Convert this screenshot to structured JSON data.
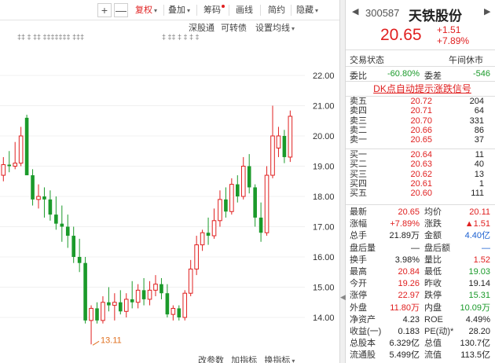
{
  "toolbar": {
    "plus": "+",
    "minus": "—",
    "items": [
      {
        "label": "复权",
        "caret": "▾",
        "active": true
      },
      {
        "label": "叠加",
        "caret": "▾",
        "active": false
      },
      {
        "label": "筹码",
        "caret": "",
        "active": false,
        "dot": true
      },
      {
        "label": "画线",
        "caret": "",
        "active": false
      },
      {
        "label": "简约",
        "caret": "",
        "active": false
      },
      {
        "label": "隐藏",
        "caret": "▾",
        "active": false
      }
    ]
  },
  "chart_options": {
    "shenguton": "深股通",
    "kezhuanzhai": "可转债",
    "setma": "设置均线",
    "setma_caret": "▾",
    "markers_left": "‡‡   ‡   ‡‡   ‡‡‡‡‡‡‡   ‡‡‡",
    "markers_right": "‡   ‡‡   ‡   ‡   ‡   ‡"
  },
  "bottom_links": {
    "item1": "改参数",
    "item2": "加指标",
    "item3": "换指标",
    "caret": "▾"
  },
  "chart_data": {
    "type": "candlestick",
    "ylim": [
      13.0,
      22.9
    ],
    "y_ticks": [
      "22.00",
      "21.00",
      "20.00",
      "19.00",
      "18.00",
      "17.00",
      "16.00",
      "15.00",
      "14.00"
    ],
    "min_annotation": "13.11",
    "up_color": "#e02020",
    "down_color": "#1a9a2a",
    "candles": [
      {
        "o": 18.7,
        "h": 19.3,
        "l": 18.5,
        "c": 19.05
      },
      {
        "o": 19.05,
        "h": 19.5,
        "l": 18.8,
        "c": 19.0
      },
      {
        "o": 19.0,
        "h": 19.8,
        "l": 18.9,
        "c": 19.1
      },
      {
        "o": 19.1,
        "h": 20.3,
        "l": 19.0,
        "c": 20.0
      },
      {
        "o": 20.6,
        "h": 20.7,
        "l": 18.7,
        "c": 18.7
      },
      {
        "o": 18.7,
        "h": 18.9,
        "l": 17.7,
        "c": 17.9
      },
      {
        "o": 17.9,
        "h": 18.4,
        "l": 17.6,
        "c": 18.0
      },
      {
        "o": 18.0,
        "h": 18.3,
        "l": 17.3,
        "c": 17.9
      },
      {
        "o": 17.9,
        "h": 18.2,
        "l": 17.2,
        "c": 17.4
      },
      {
        "o": 17.4,
        "h": 18.0,
        "l": 16.9,
        "c": 17.1
      },
      {
        "o": 17.1,
        "h": 17.7,
        "l": 16.5,
        "c": 17.0
      },
      {
        "o": 17.0,
        "h": 17.4,
        "l": 16.3,
        "c": 16.7
      },
      {
        "o": 16.7,
        "h": 17.0,
        "l": 15.8,
        "c": 16.0
      },
      {
        "o": 16.0,
        "h": 16.6,
        "l": 15.5,
        "c": 15.8
      },
      {
        "o": 15.8,
        "h": 16.0,
        "l": 13.8,
        "c": 13.9
      },
      {
        "o": 13.9,
        "h": 14.4,
        "l": 13.11,
        "c": 14.3
      },
      {
        "o": 14.3,
        "h": 14.5,
        "l": 13.8,
        "c": 13.9
      },
      {
        "o": 13.9,
        "h": 14.7,
        "l": 13.8,
        "c": 14.5
      },
      {
        "o": 14.5,
        "h": 15.0,
        "l": 14.2,
        "c": 14.4
      },
      {
        "o": 14.4,
        "h": 14.8,
        "l": 13.9,
        "c": 14.5
      },
      {
        "o": 14.5,
        "h": 14.9,
        "l": 14.1,
        "c": 14.2
      },
      {
        "o": 14.2,
        "h": 14.8,
        "l": 14.0,
        "c": 14.6
      },
      {
        "o": 14.6,
        "h": 15.2,
        "l": 14.3,
        "c": 14.5
      },
      {
        "o": 14.5,
        "h": 15.1,
        "l": 14.3,
        "c": 14.9
      },
      {
        "o": 14.9,
        "h": 15.3,
        "l": 14.4,
        "c": 14.6
      },
      {
        "o": 14.6,
        "h": 15.2,
        "l": 14.4,
        "c": 14.9
      },
      {
        "o": 14.9,
        "h": 15.4,
        "l": 14.7,
        "c": 15.1
      },
      {
        "o": 15.1,
        "h": 15.3,
        "l": 14.6,
        "c": 14.8
      },
      {
        "o": 14.8,
        "h": 15.1,
        "l": 14.0,
        "c": 14.1
      },
      {
        "o": 14.1,
        "h": 14.4,
        "l": 13.9,
        "c": 14.3
      },
      {
        "o": 14.3,
        "h": 14.4,
        "l": 13.9,
        "c": 14.0
      },
      {
        "o": 14.0,
        "h": 14.9,
        "l": 13.9,
        "c": 14.8
      },
      {
        "o": 14.8,
        "h": 15.9,
        "l": 14.7,
        "c": 15.6
      },
      {
        "o": 15.6,
        "h": 16.7,
        "l": 15.4,
        "c": 16.4
      },
      {
        "o": 16.4,
        "h": 16.9,
        "l": 16.2,
        "c": 16.8
      },
      {
        "o": 16.8,
        "h": 17.3,
        "l": 16.4,
        "c": 16.7
      },
      {
        "o": 16.7,
        "h": 17.6,
        "l": 16.6,
        "c": 17.2
      },
      {
        "o": 17.2,
        "h": 18.2,
        "l": 17.0,
        "c": 17.9
      },
      {
        "o": 17.9,
        "h": 18.3,
        "l": 17.3,
        "c": 17.5
      },
      {
        "o": 17.5,
        "h": 18.6,
        "l": 17.4,
        "c": 18.4
      },
      {
        "o": 18.4,
        "h": 18.7,
        "l": 17.8,
        "c": 18.0
      },
      {
        "o": 18.0,
        "h": 19.3,
        "l": 17.9,
        "c": 19.0
      },
      {
        "o": 19.0,
        "h": 19.4,
        "l": 18.1,
        "c": 18.3
      },
      {
        "o": 18.3,
        "h": 18.4,
        "l": 17.0,
        "c": 17.3
      },
      {
        "o": 17.3,
        "h": 17.8,
        "l": 16.5,
        "c": 16.8
      },
      {
        "o": 16.8,
        "h": 19.0,
        "l": 16.7,
        "c": 18.7
      },
      {
        "o": 18.7,
        "h": 21.0,
        "l": 18.6,
        "c": 20.0
      },
      {
        "o": 19.6,
        "h": 20.3,
        "l": 19.3,
        "c": 20.0
      },
      {
        "o": 20.0,
        "h": 20.2,
        "l": 19.1,
        "c": 19.3
      },
      {
        "o": 19.3,
        "h": 20.84,
        "l": 19.14,
        "c": 20.65
      }
    ]
  },
  "quote": {
    "nav_prev": "◀",
    "nav_next": "▶",
    "code": "300587",
    "name": "天铁股份",
    "price": "20.65",
    "change": "+1.51",
    "change_pct": "+7.89%",
    "trade_status_label": "交易状态",
    "trade_status_value": "午间休市",
    "weibi_label": "委比",
    "weibi_value": "-60.80%",
    "weicha_label": "委差",
    "weicha_value": "-546",
    "dk_link": "DK点自动提示涨跌信号",
    "sells": [
      {
        "label": "卖五",
        "price": "20.72",
        "vol": "204"
      },
      {
        "label": "卖四",
        "price": "20.71",
        "vol": "64"
      },
      {
        "label": "卖三",
        "price": "20.70",
        "vol": "331"
      },
      {
        "label": "卖二",
        "price": "20.66",
        "vol": "86"
      },
      {
        "label": "卖一",
        "price": "20.65",
        "vol": "37"
      }
    ],
    "buys": [
      {
        "label": "买一",
        "price": "20.64",
        "vol": "11"
      },
      {
        "label": "买二",
        "price": "20.63",
        "vol": "40"
      },
      {
        "label": "买三",
        "price": "20.62",
        "vol": "13"
      },
      {
        "label": "买四",
        "price": "20.61",
        "vol": "1"
      },
      {
        "label": "买五",
        "price": "20.60",
        "vol": "111"
      }
    ],
    "stats": [
      {
        "l1": "最新",
        "v1": "20.65",
        "c1": "red",
        "l2": "均价",
        "v2": "20.11",
        "c2": "red"
      },
      {
        "l1": "涨幅",
        "v1": "+7.89%",
        "c1": "red",
        "l2": "涨跌",
        "v2": "▲1.51",
        "c2": "red"
      },
      {
        "l1": "总手",
        "v1": "21.89万",
        "c1": "dark",
        "l2": "金额",
        "v2": "4.40亿",
        "c2": "blue"
      },
      {
        "l1": "盘后量",
        "v1": "—",
        "c1": "dark",
        "l2": "盘后额",
        "v2": "—",
        "c2": "blue"
      },
      {
        "l1": "换手",
        "v1": "3.98%",
        "c1": "dark",
        "l2": "量比",
        "v2": "1.52",
        "c2": "red"
      },
      {
        "l1": "最高",
        "v1": "20.84",
        "c1": "red",
        "l2": "最低",
        "v2": "19.03",
        "c2": "green"
      },
      {
        "l1": "今开",
        "v1": "19.26",
        "c1": "red",
        "l2": "昨收",
        "v2": "19.14",
        "c2": "dark"
      },
      {
        "l1": "涨停",
        "v1": "22.97",
        "c1": "red",
        "l2": "跌停",
        "v2": "15.31",
        "c2": "green"
      },
      {
        "l1": "外盘",
        "v1": "11.80万",
        "c1": "red",
        "l2": "内盘",
        "v2": "10.09万",
        "c2": "green"
      },
      {
        "l1": "净资产",
        "v1": "4.23",
        "c1": "dark",
        "l2": "ROE",
        "v2": "4.49%",
        "c2": "dark"
      },
      {
        "l1": "收益(一)",
        "v1": "0.183",
        "c1": "dark",
        "l2": "PE(动)*",
        "v2": "28.20",
        "c2": "dark"
      },
      {
        "l1": "总股本",
        "v1": "6.329亿",
        "c1": "dark",
        "l2": "总值",
        "v2": "130.7亿",
        "c2": "dark"
      },
      {
        "l1": "流通股",
        "v1": "5.499亿",
        "c1": "dark",
        "l2": "流值",
        "v2": "113.5亿",
        "c2": "dark"
      }
    ]
  }
}
